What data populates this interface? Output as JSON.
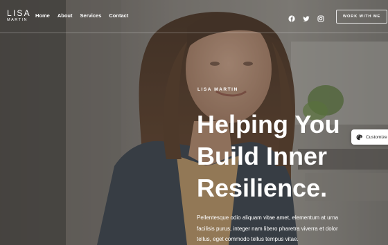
{
  "brand": {
    "name_line1": "LISA",
    "name_line2": "MARTIN"
  },
  "nav": {
    "items": [
      {
        "label": "Home"
      },
      {
        "label": "About"
      },
      {
        "label": "Services"
      },
      {
        "label": "Contact"
      }
    ]
  },
  "social": [
    "facebook-icon",
    "twitter-icon",
    "instagram-icon"
  ],
  "cta": {
    "label": "WORK WITH ME"
  },
  "hero": {
    "eyebrow": "LISA MARTIN",
    "headline": [
      "Helping You",
      "Build Inner",
      "Resilience."
    ],
    "description": [
      "Pellentesque odio aliquam vitae amet, elementum at urna",
      "facilisis purus, integer nam libero pharetra viverra et dolor",
      "tellus, eget commodo tellus tempus vitae."
    ]
  },
  "customize": {
    "label": "Customize"
  },
  "colors": {
    "overlay": "#3a3633",
    "text": "#ffffff"
  }
}
